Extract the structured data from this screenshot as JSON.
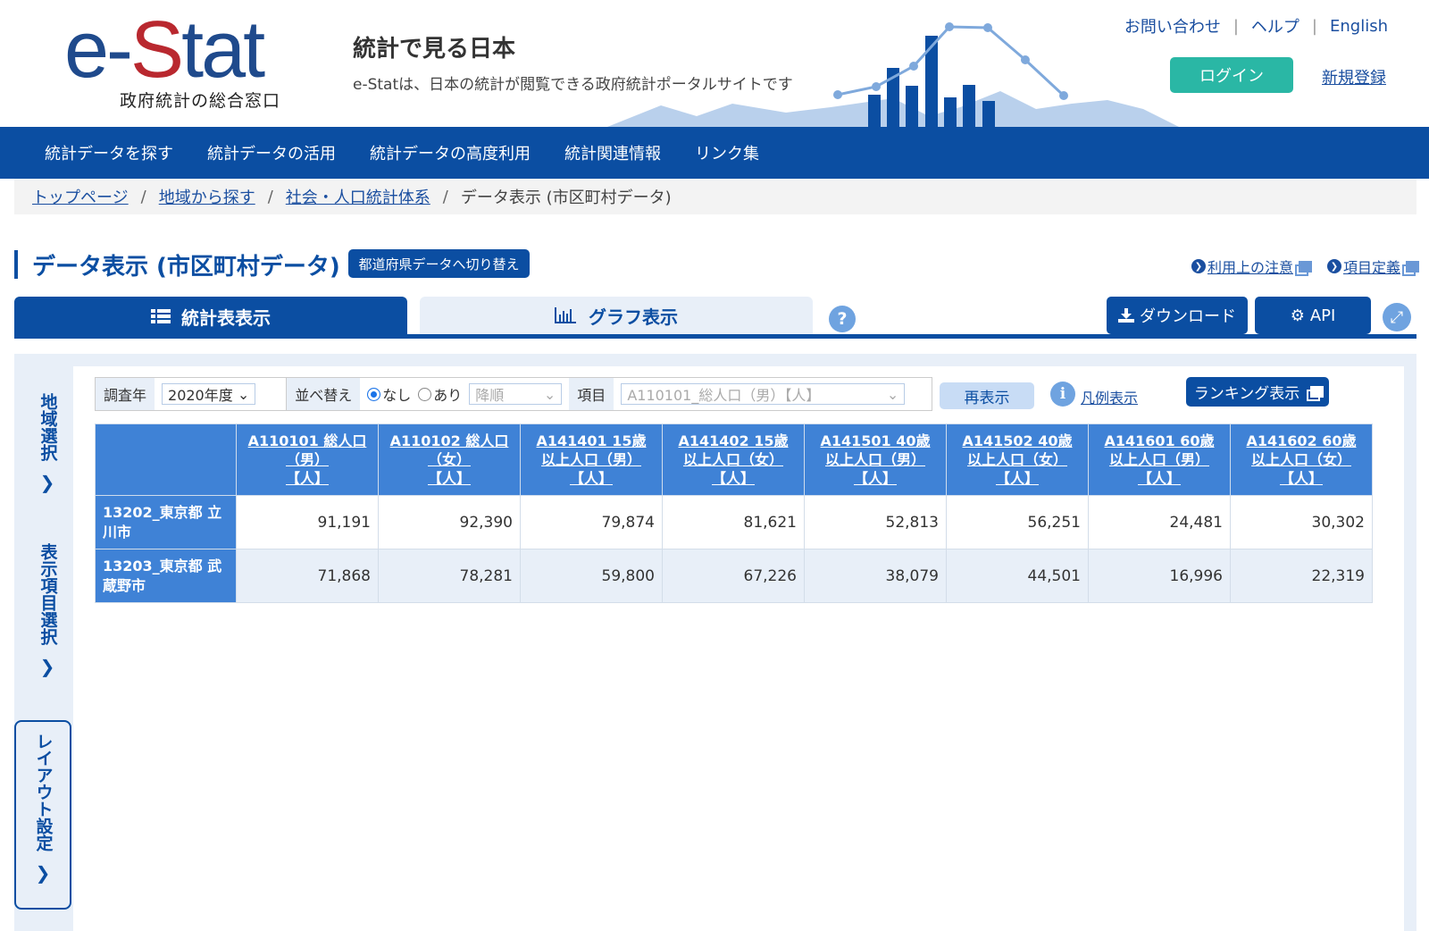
{
  "header": {
    "logo_prefix": "e-",
    "logo_s": "S",
    "logo_suffix": "tat",
    "logo_subtitle": "政府統計の総合窓口",
    "tagline_title": "統計で見る日本",
    "tagline_sub": "e-Statは、日本の統計が閲覧できる政府統計ポータルサイトです",
    "links": [
      "お問い合わせ",
      "ヘルプ",
      "English"
    ],
    "login_label": "ログイン",
    "register_label": "新規登録"
  },
  "nav": {
    "items": [
      "統計データを探す",
      "統計データの活用",
      "統計データの高度利用",
      "統計関連情報",
      "リンク集"
    ]
  },
  "breadcrumb": {
    "links": [
      "トップページ",
      "地域から探す",
      "社会・人口統計体系"
    ],
    "current": "データ表示 (市区町村データ)",
    "separator": "/"
  },
  "page": {
    "title": "データ表示 (市区町村データ)",
    "switch_label": "都道府県データへ切り替え",
    "notes_link": "利用上の注意",
    "definitions_link": "項目定義"
  },
  "tabs": {
    "table_label": "統計表表示",
    "graph_label": "グラフ表示",
    "help_glyph": "?",
    "download_label": "ダウンロード",
    "api_label": "API"
  },
  "side_tabs": {
    "region": "地域選択",
    "items": "表示項目選択",
    "layout": "レイアウト設定",
    "chevron": "❯"
  },
  "filters": {
    "year_label": "調査年",
    "year_value": "2020年度",
    "sort_label": "並べ替え",
    "sort_none": "なし",
    "sort_yes": "あり",
    "sort_selected": "なし",
    "order_value": "降順",
    "item_label": "項目",
    "item_value": "A110101_総人口（男）【人】",
    "redisplay_label": "再表示",
    "legend_label": "凡例表示",
    "ranking_label": "ランキング表示"
  },
  "table": {
    "columns": [
      {
        "l1": "A110101 総人口",
        "l2": "（男）",
        "l3": "【人】"
      },
      {
        "l1": "A110102 総人口",
        "l2": "（女）",
        "l3": "【人】"
      },
      {
        "l1": "A141401 15歳",
        "l2": "以上人口（男）",
        "l3": "【人】"
      },
      {
        "l1": "A141402 15歳",
        "l2": "以上人口（女）",
        "l3": "【人】"
      },
      {
        "l1": "A141501 40歳",
        "l2": "以上人口（男）",
        "l3": "【人】"
      },
      {
        "l1": "A141502 40歳",
        "l2": "以上人口（女）",
        "l3": "【人】"
      },
      {
        "l1": "A141601 60歳",
        "l2": "以上人口（男）",
        "l3": "【人】"
      },
      {
        "l1": "A141602 60歳",
        "l2": "以上人口（女）",
        "l3": "【人】"
      }
    ],
    "rows": [
      {
        "l1": "13202_東京都 立",
        "l2": "川市",
        "values": [
          "91,191",
          "92,390",
          "79,874",
          "81,621",
          "52,813",
          "56,251",
          "24,481",
          "30,302"
        ]
      },
      {
        "l1": "13203_東京都 武",
        "l2": "蔵野市",
        "values": [
          "71,868",
          "78,281",
          "59,800",
          "67,226",
          "38,079",
          "44,501",
          "16,996",
          "22,319"
        ]
      }
    ]
  },
  "colors": {
    "brand_blue": "#0b4ea2",
    "header_cell": "#3f82d6",
    "login_green": "#2ab7a5",
    "logo_red": "#b9282f"
  }
}
